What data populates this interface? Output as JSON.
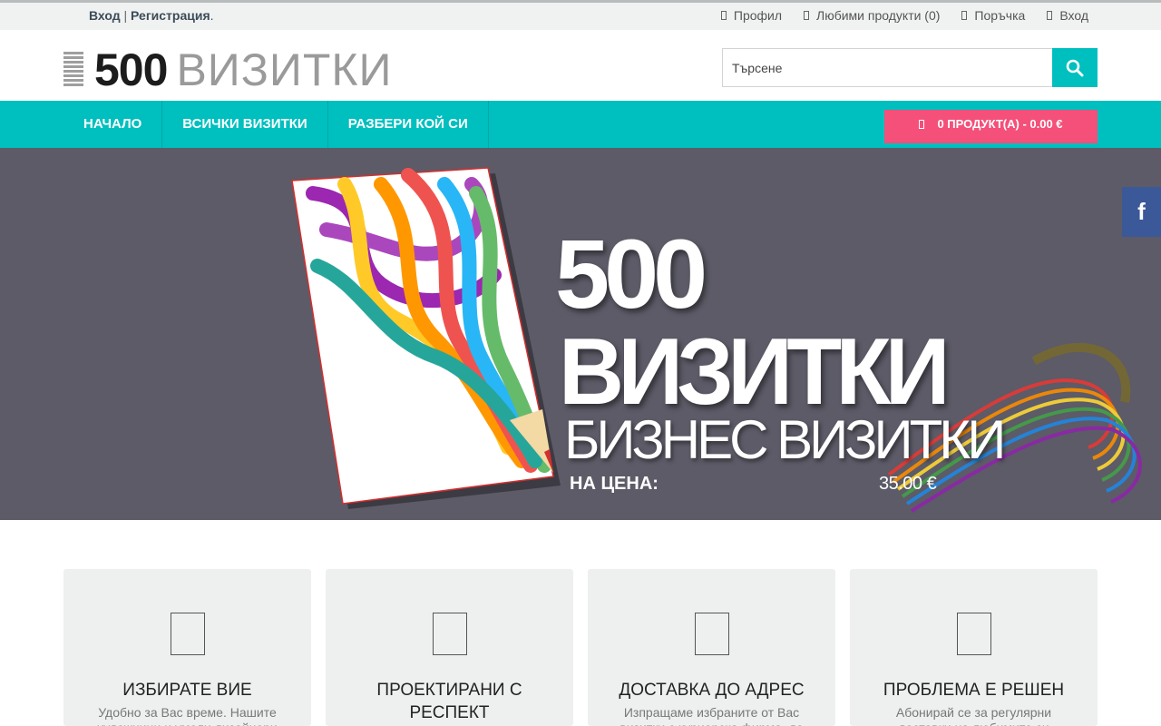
{
  "topbar": {
    "login": "Вход",
    "separator": "|",
    "register": "Регистрация",
    "dot": ".",
    "links": [
      {
        "icon": "user-icon",
        "label": "Профил"
      },
      {
        "icon": "heart-icon",
        "label": "Любими продукти (0)"
      },
      {
        "icon": "check-icon",
        "label": "Поръчка"
      },
      {
        "icon": "lock-icon",
        "label": "Вход"
      }
    ]
  },
  "header": {
    "logo_number": "500",
    "logo_word": "ВИЗИТКИ",
    "search_placeholder": "Търсене"
  },
  "nav": {
    "items": [
      "НАЧАЛО",
      "ВСИЧКИ ВИЗИТКИ",
      "РАЗБЕРИ КОЙ СИ"
    ],
    "cart_label": "0 ПРОДУКТ(А) - 0.00 €"
  },
  "hero": {
    "line1": "500",
    "line2": "ВИЗИТКИ",
    "line3": "БИЗНЕС ВИЗИТКИ",
    "price_label": "НА ЦЕНА:",
    "price": "35.00 €"
  },
  "social": {
    "facebook": "f"
  },
  "features": [
    {
      "title": "ИЗБИРАТЕ ВИЕ",
      "desc": "Удобно за Вас време. Нашите художници и умели дизайнери"
    },
    {
      "title": "ПРОЕКТИРАНИ С РЕСПЕКТ",
      "desc": ""
    },
    {
      "title": "ДОСТАВКА ДО АДРЕС",
      "desc": "Изпращаме избраните от Вас визитки с куриерска фирма, до"
    },
    {
      "title": "ПРОБЛЕМА Е РЕШЕН",
      "desc": "Абонирай се за регулярни доставки на любимите си визитки"
    }
  ],
  "colors": {
    "accent": "#00bfbf",
    "cart": "#f4507a",
    "hero_bg": "#5c5b67",
    "facebook": "#3b5998"
  }
}
